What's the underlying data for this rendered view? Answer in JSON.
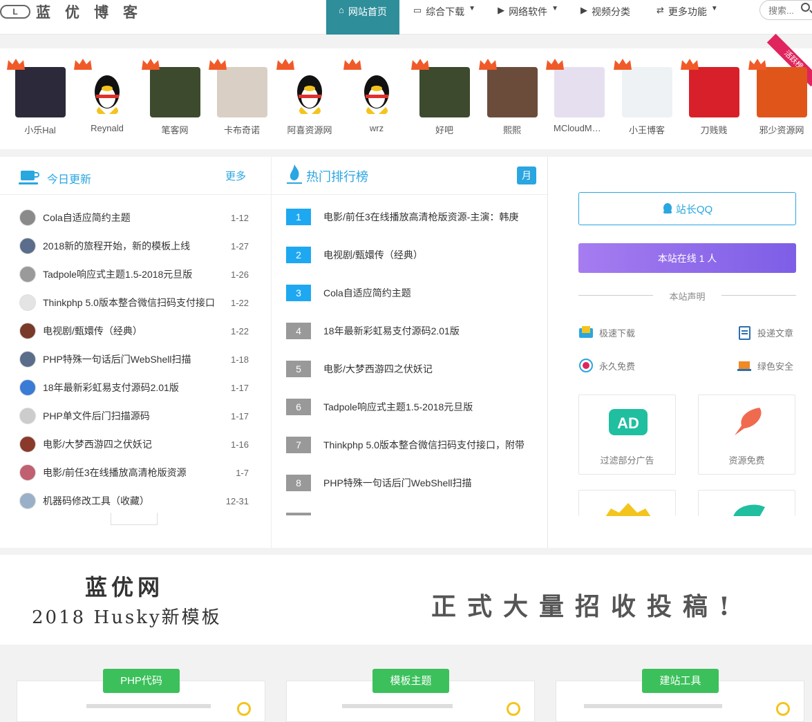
{
  "header": {
    "logo_mark": "L",
    "site_name": "蓝优博客",
    "nav": [
      {
        "label": "网站首页",
        "icon": "home-icon",
        "active": true
      },
      {
        "label": "综合下载",
        "icon": "monitor-icon",
        "dropdown": true
      },
      {
        "label": "网络软件",
        "icon": "play-circle-icon",
        "dropdown": true
      },
      {
        "label": "视频分类",
        "icon": "play-circle-icon"
      },
      {
        "label": "更多功能",
        "icon": "retweet-icon",
        "dropdown": true
      }
    ],
    "search_placeholder": "搜索..."
  },
  "friends": {
    "ribbon": "活跃榜",
    "items": [
      {
        "name": "小乐Hal",
        "color": "#2c2a3a"
      },
      {
        "name": "Reynald",
        "color": "#ffffff"
      },
      {
        "name": "笔客网",
        "color": "#3d4a2e"
      },
      {
        "name": "卡布奇诺",
        "color": "#d9cfc4"
      },
      {
        "name": "阿喜资源网",
        "color": "#ffffff"
      },
      {
        "name": "wrz",
        "color": "#ffffff"
      },
      {
        "name": "好吧",
        "color": "#3d4a2e"
      },
      {
        "name": "熙熙",
        "color": "#6b4c3b"
      },
      {
        "name": "MCloudMusic",
        "color": "#e6dff0"
      },
      {
        "name": "小王博客",
        "color": "#eef2f4"
      },
      {
        "name": "刀贱贱",
        "color": "#d8202a"
      },
      {
        "name": "邪少资源网",
        "color": "#e0561a"
      }
    ]
  },
  "today": {
    "title": "今日更新",
    "more": "更多",
    "items": [
      {
        "title": "Cola自适应简约主题",
        "date": "1-12",
        "color": "#8a8a8a"
      },
      {
        "title": "2018新的旅程开始，新的模板上线",
        "date": "1-27",
        "color": "#5a6d8a"
      },
      {
        "title": "Tadpole响应式主题1.5-2018元旦版",
        "date": "1-26",
        "color": "#9a9a9a"
      },
      {
        "title": "Thinkphp 5.0版本整合微信扫码支付接口",
        "date": "1-22",
        "color": "#e4e4e4"
      },
      {
        "title": "电视剧/甄嬛传（经典）",
        "date": "1-22",
        "color": "#7a3a2a"
      },
      {
        "title": "PHP特殊一句话后门WebShell扫描",
        "date": "1-18",
        "color": "#5a6d8a"
      },
      {
        "title": "18年最新彩虹易支付源码2.01版",
        "date": "1-17",
        "color": "#3a7bd5"
      },
      {
        "title": "PHP单文件后门扫描源码",
        "date": "1-17",
        "color": "#cccccc"
      },
      {
        "title": "电影/大梦西游四之伏妖记",
        "date": "1-16",
        "color": "#8a3a2a"
      },
      {
        "title": "电影/前任3在线播放高清枪版资源",
        "date": "1-7",
        "color": "#c06070"
      },
      {
        "title": "机器码修改工具（收藏）",
        "date": "12-31",
        "color": "#9ab0c8"
      }
    ]
  },
  "rank": {
    "title": "热门排行榜",
    "badge": "月",
    "items": [
      {
        "num": "1",
        "title": "电影/前任3在线播放高清枪版资源-主演：韩庚",
        "color": "#1ea8f2"
      },
      {
        "num": "2",
        "title": "电视剧/甄嬛传（经典）",
        "color": "#1ea8f2"
      },
      {
        "num": "3",
        "title": "Cola自适应简约主题",
        "color": "#1ea8f2"
      },
      {
        "num": "4",
        "title": "18年最新彩虹易支付源码2.01版",
        "color": "#999999"
      },
      {
        "num": "5",
        "title": "电影/大梦西游四之伏妖记",
        "color": "#999999"
      },
      {
        "num": "6",
        "title": "Tadpole响应式主题1.5-2018元旦版",
        "color": "#999999"
      },
      {
        "num": "7",
        "title": "Thinkphp 5.0版本整合微信扫码支付接口，附带",
        "color": "#999999"
      },
      {
        "num": "8",
        "title": "PHP特殊一句话后门WebShell扫描",
        "color": "#999999"
      }
    ]
  },
  "sidebar": {
    "qq_label": "站长QQ",
    "online_label": "本站在线 1 人",
    "declaration": "本站声明",
    "features": [
      {
        "label": "极速下载",
        "icon": "download-icon"
      },
      {
        "label": "投递文章",
        "icon": "document-icon"
      },
      {
        "label": "永久免费",
        "icon": "vip-icon"
      },
      {
        "label": "绿色安全",
        "icon": "laptop-icon"
      }
    ],
    "cards": [
      {
        "label": "过滤部分广告",
        "icon": "ad-icon"
      },
      {
        "label": "资源免费",
        "icon": "feather-icon"
      }
    ]
  },
  "banner": {
    "line1": "蓝优网",
    "line2": "2018 Husky新模板",
    "line3": "正式大量招收投稿!"
  },
  "bottom": {
    "tags": [
      "PHP代码",
      "模板主题",
      "建站工具"
    ]
  }
}
